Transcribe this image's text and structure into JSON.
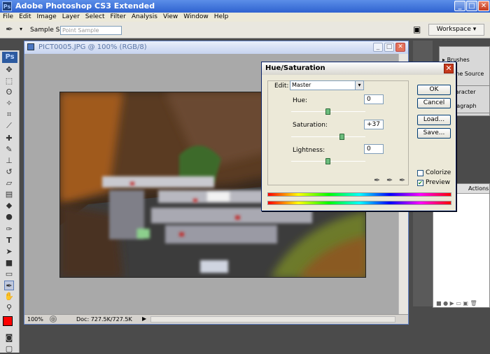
{
  "app": {
    "title": "Adobe Photoshop CS3 Extended",
    "logo": "Ps"
  },
  "menu": [
    "File",
    "Edit",
    "Image",
    "Layer",
    "Select",
    "Filter",
    "Analysis",
    "View",
    "Window",
    "Help"
  ],
  "options": {
    "sample_label": "Sample Size:",
    "sample_value": "Point Sample",
    "workspace_label": "Workspace ▾"
  },
  "document": {
    "title": "PICT0005.JPG @ 100% (RGB/8)",
    "zoom": "100%",
    "doc_size": "Doc: 727.5K/727.5K"
  },
  "panels": {
    "brushes": "Brushes",
    "clone_source": "Clone Source",
    "character": "Character",
    "paragraph": "Paragraph",
    "actions": "Actions"
  },
  "dialog": {
    "title": "Hue/Saturation",
    "edit_label": "Edit:",
    "edit_value": "Master",
    "hue_label": "Hue:",
    "hue_value": "0",
    "saturation_label": "Saturation:",
    "saturation_value": "+37",
    "lightness_label": "Lightness:",
    "lightness_value": "0",
    "buttons": {
      "ok": "OK",
      "cancel": "Cancel",
      "load": "Load...",
      "save": "Save..."
    },
    "colorize_label": "Colorize",
    "colorize_checked": false,
    "preview_label": "Preview",
    "preview_checked": true,
    "sliders": {
      "hue_fraction": 0.5,
      "saturation_fraction": 0.685,
      "lightness_fraction": 0.5
    }
  },
  "colors": {
    "foreground": "#ff0000",
    "background": "#ffffff",
    "accent": "#0a246a"
  }
}
